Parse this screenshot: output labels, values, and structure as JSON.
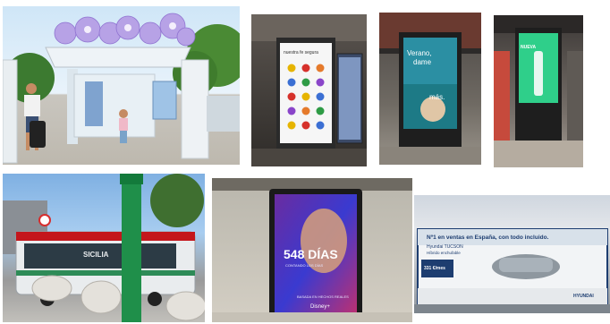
{
  "page": {
    "background": "#ffffff"
  },
  "images": [
    {
      "caption": "bus shelter with flower roof and backlit ads"
    },
    {
      "ad_text": "nuestra fe segura",
      "colors": [
        "#e6b400",
        "#d6312b",
        "#3b6fd3",
        "#2e9b45",
        "#8a45c9",
        "#e57a2b"
      ]
    },
    {
      "ad_lines": [
        "Verano,",
        "dame",
        "más."
      ]
    },
    {
      "ad_text": "NUEVA"
    },
    {
      "bus_text": "SICILIA"
    },
    {
      "ad_title": "548 DÍAS",
      "ad_subtitle": "CONTANDO LOS DÍAS",
      "ad_tagline": "BASADA EN HECHOS REALES",
      "ad_brand": "Disney+"
    },
    {
      "ad_headline": "Nº1 en ventas en España, con todo incluido.",
      "ad_model": "Hyundai TUCSON",
      "ad_sub": "Híbrido enchufable",
      "ad_price": "331 €/mes",
      "ad_brand": "HYUNDAI"
    }
  ]
}
